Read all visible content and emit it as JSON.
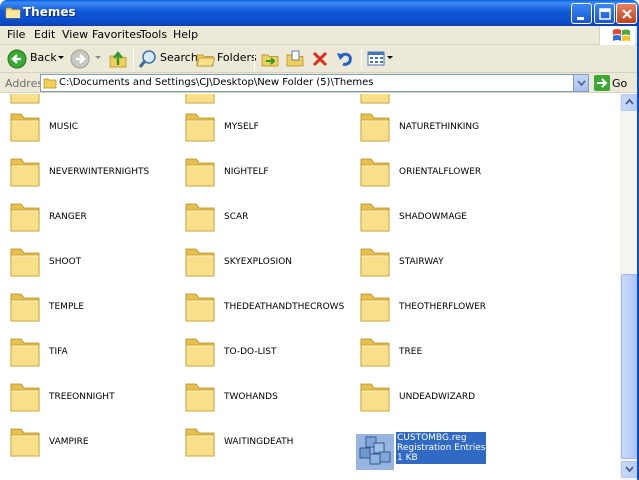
{
  "window": {
    "title": "Themes"
  },
  "menu": [
    "File",
    "Edit",
    "View",
    "Favorites",
    "Tools",
    "Help"
  ],
  "toolbar": {
    "back_label": "Back",
    "search_label": "Search",
    "folders_label": "Folders"
  },
  "address": {
    "label": "Address",
    "path": "C:\\Documents and Settings\\CJ\\Desktop\\New Folder (5)\\Themes",
    "go_label": "Go"
  },
  "folders": [
    [
      "MUSIC",
      "MYSELF",
      "NATURETHINKING"
    ],
    [
      "NEVERWINTERNIGHTS",
      "NIGHTELF",
      "ORIENTALFLOWER"
    ],
    [
      "RANGER",
      "SCAR",
      "SHADOWMAGE"
    ],
    [
      "SHOOT",
      "SKYEXPLOSION",
      "STAIRWAY"
    ],
    [
      "TEMPLE",
      "THEDEATHANDTHECROWS",
      "THEOTHERFLOWER"
    ],
    [
      "TIFA",
      "TO-DO-LIST",
      "TREE"
    ],
    [
      "TREEONNIGHT",
      "TWOHANDS",
      "UNDEADWIZARD"
    ],
    [
      "VAMPIRE",
      "WAITINGDEATH"
    ]
  ],
  "registry_file": {
    "name": "CUSTOMBG.reg",
    "type": "Registration Entries",
    "size": "1 KB",
    "selected": true
  }
}
